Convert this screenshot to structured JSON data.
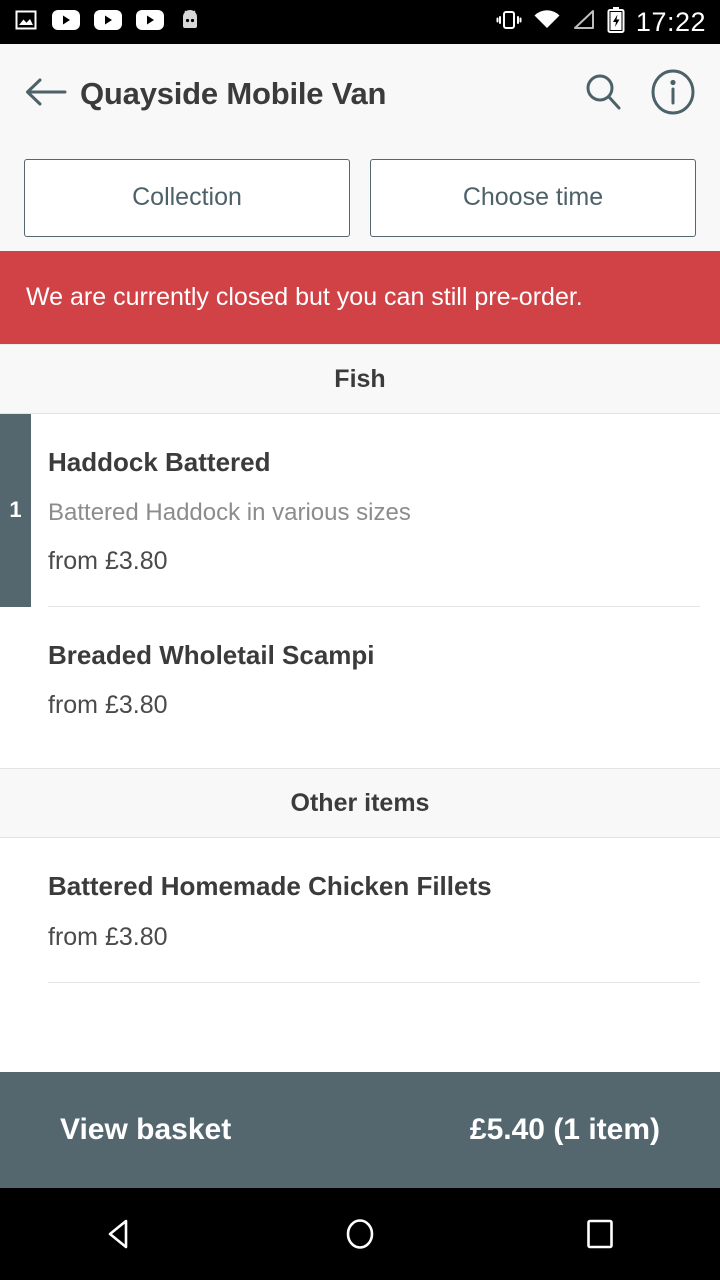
{
  "status_bar": {
    "time": "17:22",
    "left_icons": [
      "image-icon",
      "youtube-icon",
      "youtube-icon",
      "youtube-icon",
      "android-icon"
    ],
    "right_icons": [
      "vibrate-icon",
      "wifi-icon",
      "cell-signal-icon",
      "battery-charging-icon"
    ]
  },
  "header": {
    "back_icon": "back-arrow-icon",
    "title": "Quayside Mobile Van",
    "search_icon": "search-icon",
    "info_icon": "info-icon"
  },
  "order_options": {
    "fulfilment_label": "Collection",
    "time_label": "Choose time"
  },
  "banner": {
    "message": "We are currently closed but you can still pre-order.",
    "color": "#d14247"
  },
  "menu": {
    "sections": [
      {
        "title": "Fish",
        "items": [
          {
            "name": "Haddock Battered",
            "description": "Battered Haddock in various sizes",
            "price": "from £3.80",
            "quantity": "1"
          },
          {
            "name": "Breaded Wholetail Scampi",
            "description": "",
            "price": "from £3.80",
            "quantity": ""
          }
        ]
      },
      {
        "title": "Other items",
        "items": [
          {
            "name": "Battered Homemade Chicken Fillets",
            "description": "",
            "price": "from £3.80",
            "quantity": ""
          }
        ]
      }
    ]
  },
  "basket": {
    "label": "View basket",
    "total": "£5.40 (1 item)",
    "color": "#54676f"
  },
  "nav_bar": {
    "back": "nav-back-icon",
    "home": "nav-home-icon",
    "recents": "nav-recents-icon"
  },
  "theme": {
    "accent": "#54676f",
    "danger": "#d14247",
    "text": "#3b3b3b",
    "muted": "#8c8c8c"
  }
}
